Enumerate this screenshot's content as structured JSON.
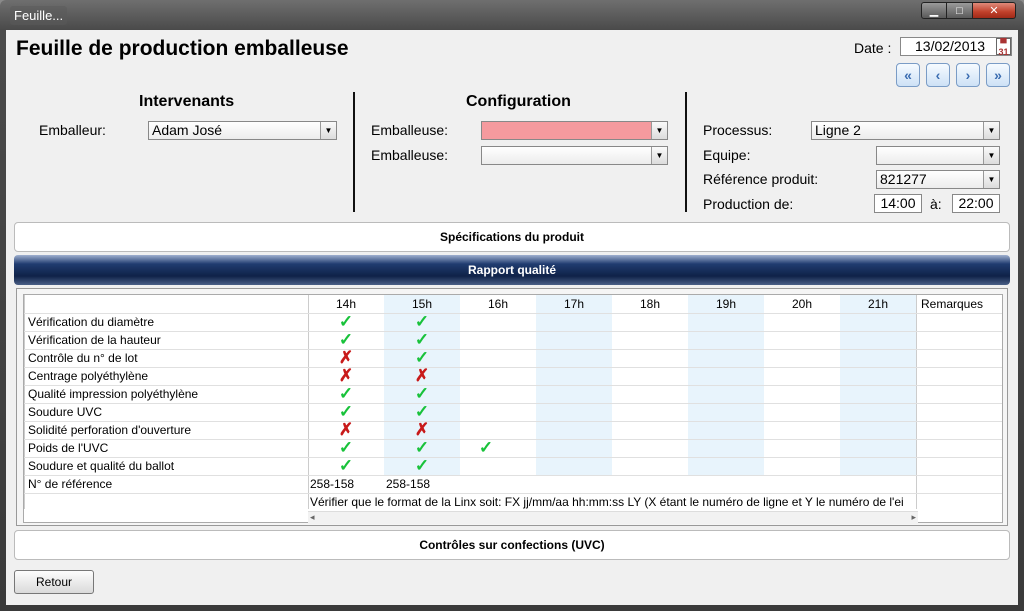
{
  "window": {
    "title": "Feuille..."
  },
  "page_title": "Feuille de production emballeuse",
  "date": {
    "label": "Date :",
    "value": "13/02/2013",
    "calendar_day": "31"
  },
  "nav": {
    "first": "«",
    "prev": "‹",
    "next": "›",
    "last": "»"
  },
  "intervenants": {
    "heading": "Intervenants",
    "emballeur_label": "Emballeur:",
    "emballeur_value": "Adam José"
  },
  "configuration": {
    "heading": "Configuration",
    "emballeuse1_label": "Emballeuse:",
    "emballeuse1_value": "",
    "emballeuse2_label": "Emballeuse:",
    "emballeuse2_value": ""
  },
  "process": {
    "processus_label": "Processus:",
    "processus_value": "Ligne 2",
    "equipe_label": "Equipe:",
    "equipe_value": "",
    "ref_label": "Référence produit:",
    "ref_value": "821277",
    "production_label": "Production de:",
    "from": "14:00",
    "to_label": "à:",
    "to": "22:00"
  },
  "sections": {
    "specs": "Spécifications du produit",
    "rapport": "Rapport qualité",
    "controles": "Contrôles sur confections (UVC)"
  },
  "grid": {
    "hours": [
      "14h",
      "15h",
      "16h",
      "17h",
      "18h",
      "19h",
      "20h",
      "21h"
    ],
    "remarks_header": "Remarques",
    "rows": [
      {
        "label": "Vérification du diamètre",
        "marks": [
          "ok",
          "ok",
          "",
          "",
          "",
          "",
          "",
          ""
        ]
      },
      {
        "label": "Vérification de la hauteur",
        "marks": [
          "ok",
          "ok",
          "",
          "",
          "",
          "",
          "",
          ""
        ]
      },
      {
        "label": "Contrôle du n° de lot",
        "marks": [
          "ko",
          "ok",
          "",
          "",
          "",
          "",
          "",
          ""
        ]
      },
      {
        "label": "Centrage polyéthylène",
        "marks": [
          "ko",
          "ko",
          "",
          "",
          "",
          "",
          "",
          ""
        ]
      },
      {
        "label": "Qualité impression polyéthylène",
        "marks": [
          "ok",
          "ok",
          "",
          "",
          "",
          "",
          "",
          ""
        ]
      },
      {
        "label": " Soudure UVC",
        "marks": [
          "ok",
          "ok",
          "",
          "",
          "",
          "",
          "",
          ""
        ]
      },
      {
        "label": "Solidité perforation d'ouverture",
        "marks": [
          "ko",
          "ko",
          "",
          "",
          "",
          "",
          "",
          ""
        ]
      },
      {
        "label": "Poids de l'UVC",
        "marks": [
          "ok",
          "ok",
          "ok",
          "",
          "",
          "",
          "",
          ""
        ]
      },
      {
        "label": "Soudure et qualité du ballot",
        "marks": [
          "ok",
          "ok",
          "",
          "",
          "",
          "",
          "",
          ""
        ]
      },
      {
        "label": "N° de référence",
        "refs": [
          "258-158",
          "258-158"
        ]
      }
    ],
    "note": "Vérifier que le format de la Linx soit: FX jj/mm/aa hh:mm:ss LY (X étant le numéro de ligne et Y le numéro de l'ei"
  },
  "retour_label": "Retour",
  "colors": {
    "ok": "#18c23a",
    "ko": "#c81a1a",
    "required": "#f59a9e",
    "band": "#e8f4fc"
  }
}
